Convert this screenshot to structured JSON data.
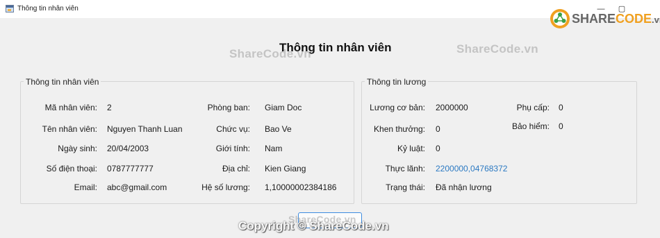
{
  "window": {
    "title": "Thông tin nhân viên",
    "min_glyph": "—",
    "max_glyph": "▢"
  },
  "main_title": "Thông tin nhân viên",
  "employee_group": {
    "legend": "Thông tin nhân viên",
    "fields": {
      "ma_nv": {
        "label": "Mã nhân viên:",
        "value": "2"
      },
      "ten_nv": {
        "label": "Tên nhân viên:",
        "value": "Nguyen Thanh Luan"
      },
      "ngay_sinh": {
        "label": "Ngày sinh:",
        "value": "20/04/2003"
      },
      "sdt": {
        "label": "Số điện thoại:",
        "value": "0787777777"
      },
      "email": {
        "label": "Email:",
        "value": "abc@gmail.com"
      },
      "phong_ban": {
        "label": "Phòng ban:",
        "value": "Giam Doc"
      },
      "chuc_vu": {
        "label": "Chức vụ:",
        "value": "Bao Ve"
      },
      "gioi_tinh": {
        "label": "Giới tính:",
        "value": "Nam"
      },
      "dia_chi": {
        "label": "Địa chỉ:",
        "value": "Kien Giang"
      },
      "he_so_luong": {
        "label": "Hệ số lương:",
        "value": "1,10000002384186"
      }
    }
  },
  "salary_group": {
    "legend": "Thông tin lương",
    "fields": {
      "luong_co_ban": {
        "label": "Lương cơ bản:",
        "value": "2000000"
      },
      "khen_thuong": {
        "label": "Khen thưởng:",
        "value": "0"
      },
      "ky_luat": {
        "label": "Kỷ luật:",
        "value": "0"
      },
      "thuc_lanh": {
        "label": "Thực lãnh:",
        "value": "2200000,04768372"
      },
      "trang_thai": {
        "label": "Trạng thái:",
        "value": "Đã nhận lương"
      },
      "phu_cap": {
        "label": "Phụ cấp:",
        "value": "0"
      },
      "bao_hiem": {
        "label": "Bảo hiểm:",
        "value": "0"
      }
    }
  },
  "watermark": {
    "text": "ShareCode.vn",
    "copyright": "Copyright © ShareCode.vn",
    "logo_main": "SHARE",
    "logo_accent": "CODE",
    "logo_suffix": ".vn"
  },
  "colors": {
    "client_bg": "#f0f0f0",
    "link": "#2b79c2",
    "button_border": "#3c8be0"
  }
}
